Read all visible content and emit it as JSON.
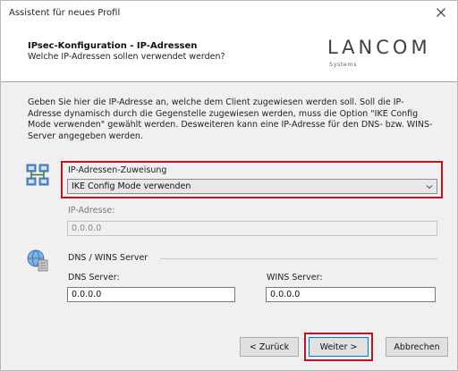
{
  "window": {
    "title": "Assistent für neues Profil"
  },
  "header": {
    "title": "IPsec-Konfiguration - IP-Adressen",
    "subtitle": "Welche IP-Adressen sollen verwendet werden?",
    "logo_text": "LANCOM",
    "logo_sub": "Systems"
  },
  "intro": {
    "text": "Geben Sie hier die IP-Adresse an, welche dem Client zugewiesen werden soll. Soll die IP-Adresse dynamisch durch die Gegenstelle zugewiesen werden, muss die Option \"IKE Config Mode verwenden\" gewählt werden. Desweiteren kann eine IP-Adresse für den DNS- bzw. WINS-Server angegeben werden."
  },
  "ip_assignment": {
    "label": "IP-Adressen-Zuweisung",
    "selected": "IKE Config Mode verwenden"
  },
  "ip_address": {
    "label": "IP-Adresse:",
    "value": "0.0.0.0"
  },
  "dns_wins": {
    "group_label": "DNS / WINS Server",
    "dns_label": "DNS Server:",
    "dns_value": "0.0.0.0",
    "wins_label": "WINS Server:",
    "wins_value": "0.0.0.0"
  },
  "buttons": {
    "back": "< Zurück",
    "next": "Weiter >",
    "cancel": "Abbrechen"
  },
  "colors": {
    "highlight": "#c1121f",
    "dialog_bg": "#f0f0f0"
  },
  "icons": [
    "close-icon",
    "network-icon",
    "globe-server-icon",
    "chevron-down-icon"
  ]
}
